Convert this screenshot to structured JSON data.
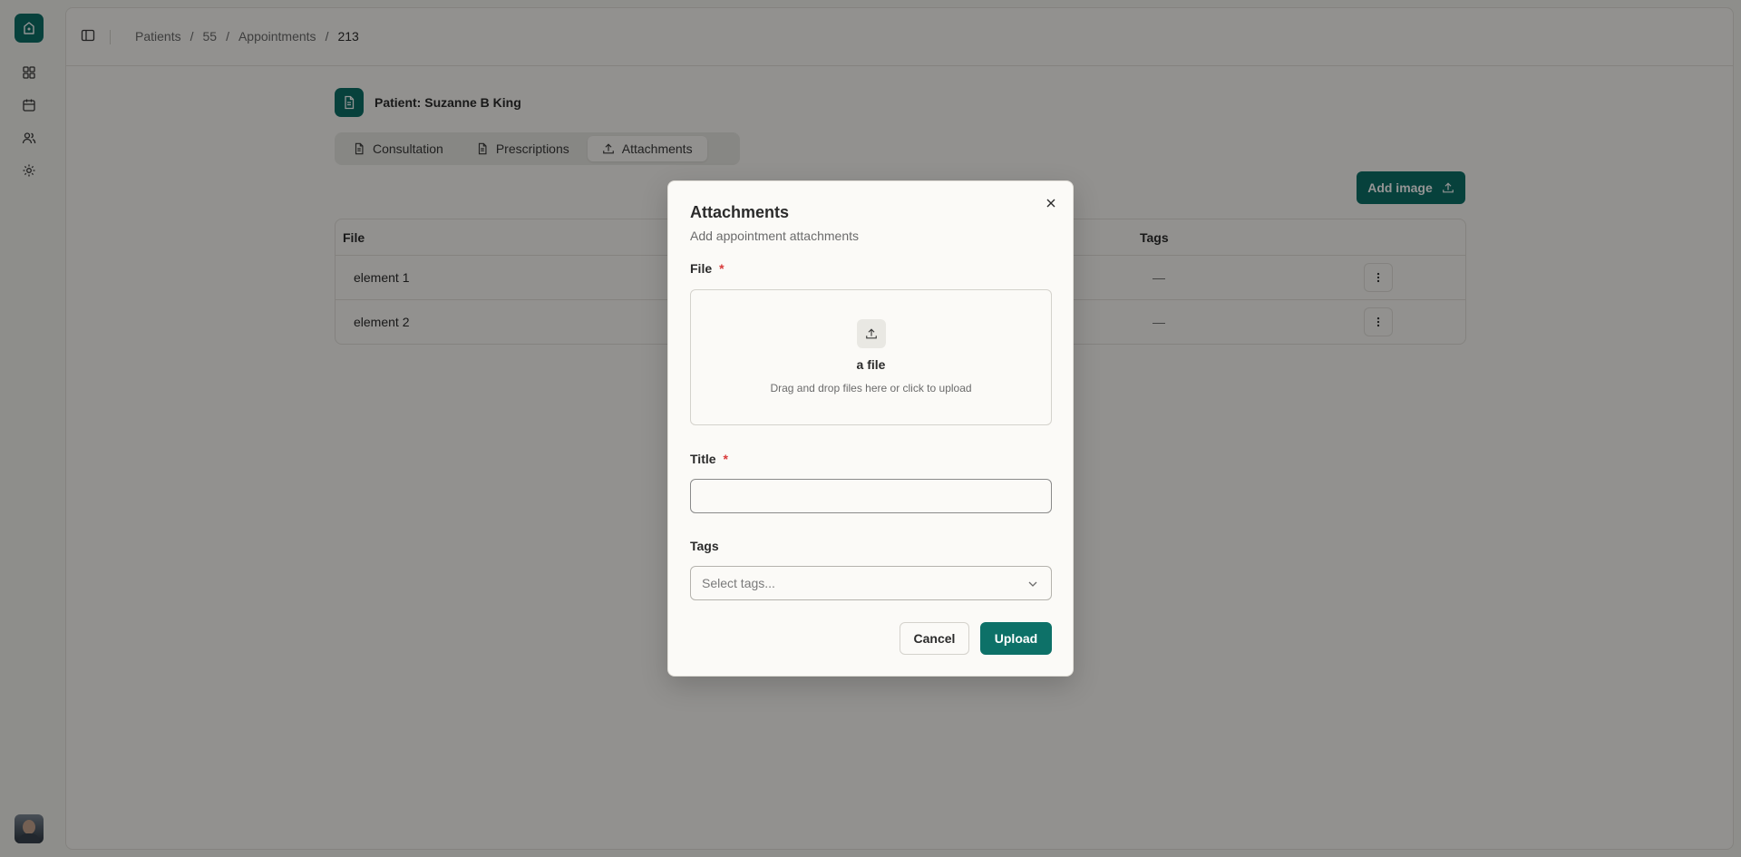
{
  "breadcrumb": {
    "items": [
      "Patients",
      "/",
      "55",
      "/",
      "Appointments",
      "/",
      "213"
    ]
  },
  "patient": {
    "label": "Patient: Suzanne B King"
  },
  "tabs": [
    {
      "label": "Consultation",
      "icon": "document-icon"
    },
    {
      "label": "Prescriptions",
      "icon": "document-icon"
    },
    {
      "label": "Attachments",
      "icon": "upload-icon",
      "active": true
    }
  ],
  "toolbar": {
    "add_image_label": "Add image"
  },
  "table": {
    "headers": {
      "file": "File",
      "tags": "Tags"
    },
    "rows": [
      {
        "file": "element 1",
        "tags": "—"
      },
      {
        "file": "element 2",
        "tags": "—"
      }
    ]
  },
  "modal": {
    "title": "Attachments",
    "description": "Add appointment attachments",
    "file_label": "File",
    "required_mark": "*",
    "dropzone_title": "a file",
    "dropzone_hint": "Drag and drop files here or click to upload",
    "title_label": "Title",
    "title_value": "",
    "tags_label": "Tags",
    "tags_placeholder": "Select tags...",
    "cancel_label": "Cancel",
    "upload_label": "Upload"
  },
  "colors": {
    "accent": "#0d7168",
    "background": "#f5f4f0",
    "required": "#d83a3a"
  }
}
